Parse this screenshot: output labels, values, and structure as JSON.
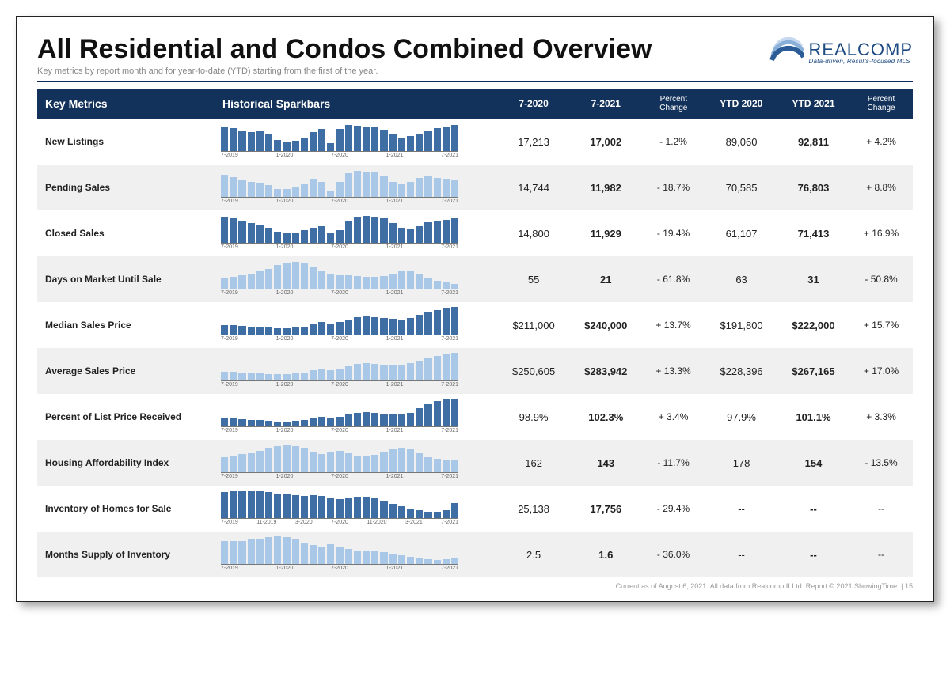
{
  "header": {
    "title": "All Residential and Condos Combined Overview",
    "subtitle": "Key metrics by report month and for year-to-date (YTD) starting from the first of the year.",
    "logo_name": "REALCOMP",
    "logo_tagline": "Data-driven, Results-focused MLS"
  },
  "columns": {
    "metrics": "Key Metrics",
    "spark": "Historical Sparkbars",
    "m0": "7-2020",
    "m1": "7-2021",
    "pc1": "Percent Change",
    "y0": "YTD 2020",
    "y1": "YTD 2021",
    "pc2": "Percent Change"
  },
  "spark_xlabels": [
    "7-2019",
    "1-2020",
    "7-2020",
    "1-2021",
    "7-2021"
  ],
  "spark_xlabels_inv": [
    "7-2019",
    "11-2019",
    "3-2020",
    "7-2020",
    "11-2020",
    "3-2021",
    "7-2021"
  ],
  "rows": [
    {
      "name": "New Listings",
      "color": "dark",
      "m0": "17,213",
      "m1": "17,002",
      "pc1": "- 1.2%",
      "y0": "89,060",
      "y1": "92,811",
      "pc2": "+ 4.2%"
    },
    {
      "name": "Pending Sales",
      "color": "light",
      "m0": "14,744",
      "m1": "11,982",
      "pc1": "- 18.7%",
      "y0": "70,585",
      "y1": "76,803",
      "pc2": "+ 8.8%"
    },
    {
      "name": "Closed Sales",
      "color": "dark",
      "m0": "14,800",
      "m1": "11,929",
      "pc1": "- 19.4%",
      "y0": "61,107",
      "y1": "71,413",
      "pc2": "+ 16.9%"
    },
    {
      "name": "Days on Market Until Sale",
      "color": "light",
      "m0": "55",
      "m1": "21",
      "pc1": "- 61.8%",
      "y0": "63",
      "y1": "31",
      "pc2": "- 50.8%"
    },
    {
      "name": "Median Sales Price",
      "color": "dark",
      "m0": "$211,000",
      "m1": "$240,000",
      "pc1": "+ 13.7%",
      "y0": "$191,800",
      "y1": "$222,000",
      "pc2": "+ 15.7%"
    },
    {
      "name": "Average Sales Price",
      "color": "light",
      "m0": "$250,605",
      "m1": "$283,942",
      "pc1": "+ 13.3%",
      "y0": "$228,396",
      "y1": "$267,165",
      "pc2": "+ 17.0%"
    },
    {
      "name": "Percent of List Price Received",
      "color": "dark",
      "m0": "98.9%",
      "m1": "102.3%",
      "pc1": "+ 3.4%",
      "y0": "97.9%",
      "y1": "101.1%",
      "pc2": "+ 3.3%"
    },
    {
      "name": "Housing Affordability Index",
      "color": "light",
      "m0": "162",
      "m1": "143",
      "pc1": "- 11.7%",
      "y0": "178",
      "y1": "154",
      "pc2": "- 13.5%"
    },
    {
      "name": "Inventory of Homes for Sale",
      "color": "dark",
      "m0": "25,138",
      "m1": "17,756",
      "pc1": "- 29.4%",
      "y0": "--",
      "y1": "--",
      "pc2": "--",
      "inv": true
    },
    {
      "name": "Months Supply of Inventory",
      "color": "light",
      "m0": "2.5",
      "m1": "1.6",
      "pc1": "- 36.0%",
      "y0": "--",
      "y1": "--",
      "pc2": "--"
    }
  ],
  "footer": "Current as of August 6, 2021. All data from Realcomp II Ltd. Report © 2021 ShowingTime. | 15",
  "chart_data": {
    "type": "bar",
    "note": "Sparkbars are small multiples, 25 months each from 7-2019 to 7-2021. Values are approximate relative heights in percent of row max as read from the image.",
    "series": [
      {
        "name": "New Listings",
        "values": [
          90,
          82,
          75,
          70,
          72,
          60,
          40,
          35,
          38,
          50,
          70,
          80,
          30,
          80,
          95,
          92,
          90,
          90,
          78,
          60,
          50,
          55,
          62,
          75,
          82,
          90,
          95
        ]
      },
      {
        "name": "Pending Sales",
        "values": [
          80,
          72,
          62,
          55,
          52,
          42,
          30,
          28,
          35,
          50,
          65,
          55,
          20,
          55,
          85,
          95,
          92,
          88,
          75,
          55,
          48,
          55,
          68,
          75,
          70,
          65,
          60
        ]
      },
      {
        "name": "Closed Sales",
        "values": [
          95,
          90,
          80,
          72,
          65,
          55,
          40,
          35,
          38,
          45,
          55,
          60,
          35,
          45,
          80,
          95,
          98,
          95,
          90,
          72,
          55,
          50,
          60,
          75,
          80,
          82,
          90
        ]
      },
      {
        "name": "Days on Market Until Sale",
        "values": [
          40,
          42,
          48,
          55,
          62,
          72,
          85,
          95,
          98,
          92,
          80,
          65,
          55,
          50,
          48,
          45,
          42,
          42,
          45,
          55,
          62,
          62,
          52,
          40,
          30,
          22,
          18
        ]
      },
      {
        "name": "Median Sales Price",
        "values": [
          35,
          35,
          32,
          30,
          28,
          25,
          22,
          22,
          25,
          30,
          38,
          45,
          40,
          45,
          55,
          62,
          65,
          62,
          60,
          58,
          55,
          60,
          72,
          82,
          90,
          95,
          100
        ]
      },
      {
        "name": "Average Sales Price",
        "values": [
          32,
          32,
          30,
          28,
          26,
          24,
          22,
          22,
          25,
          30,
          36,
          42,
          38,
          44,
          52,
          60,
          62,
          60,
          58,
          56,
          56,
          62,
          72,
          82,
          90,
          96,
          100
        ]
      },
      {
        "name": "Percent of List Price Received",
        "values": [
          28,
          28,
          26,
          24,
          22,
          20,
          18,
          18,
          20,
          24,
          30,
          34,
          30,
          34,
          42,
          50,
          52,
          48,
          44,
          42,
          42,
          50,
          65,
          80,
          92,
          98,
          100
        ]
      },
      {
        "name": "Housing Affordability Index",
        "values": [
          55,
          60,
          65,
          70,
          78,
          88,
          95,
          98,
          95,
          88,
          75,
          65,
          72,
          78,
          70,
          60,
          58,
          62,
          72,
          82,
          88,
          82,
          68,
          55,
          48,
          45,
          44
        ]
      },
      {
        "name": "Inventory of Homes for Sale",
        "values": [
          95,
          96,
          97,
          98,
          98,
          95,
          90,
          85,
          82,
          80,
          82,
          80,
          72,
          70,
          74,
          78,
          78,
          72,
          62,
          52,
          42,
          34,
          28,
          24,
          22,
          30,
          55
        ]
      },
      {
        "name": "Months Supply of Inventory",
        "values": [
          82,
          82,
          84,
          88,
          92,
          96,
          100,
          96,
          88,
          78,
          70,
          62,
          72,
          62,
          55,
          50,
          48,
          46,
          42,
          38,
          32,
          26,
          20,
          16,
          14,
          16,
          22
        ]
      }
    ]
  }
}
